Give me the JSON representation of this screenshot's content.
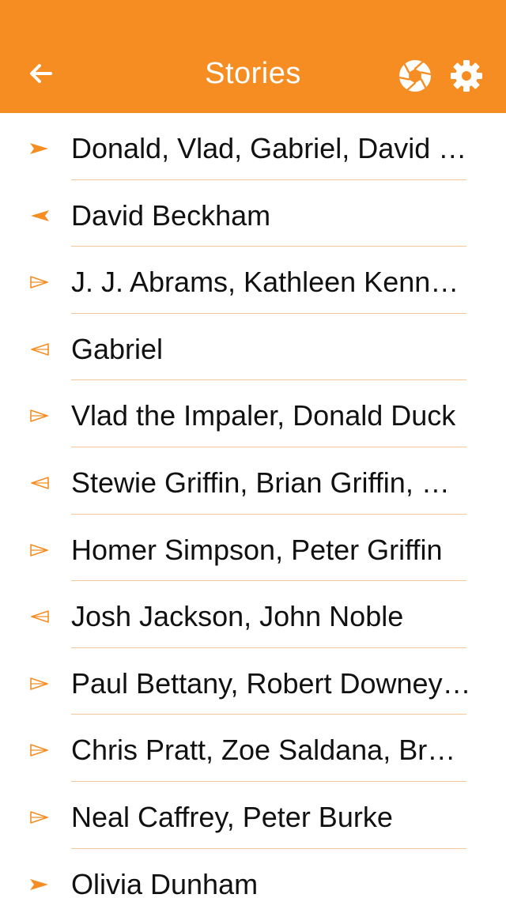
{
  "colors": {
    "accent": "#f68d23",
    "text": "#111111",
    "divider": "#f3c89a",
    "on_accent": "#ffffff"
  },
  "header": {
    "title": "Stories",
    "back_icon": "arrow-left-icon",
    "camera_icon": "camera-aperture-icon",
    "settings_icon": "gear-icon"
  },
  "stories": [
    {
      "label": "Donald, Vlad, Gabriel, David B…",
      "direction": "sent",
      "style": "filled"
    },
    {
      "label": "David Beckham",
      "direction": "received",
      "style": "filled"
    },
    {
      "label": "J. J. Abrams, Kathleen Kennedy",
      "direction": "sent",
      "style": "outline"
    },
    {
      "label": "Gabriel",
      "direction": "received",
      "style": "outline"
    },
    {
      "label": "Vlad the Impaler, Donald Duck",
      "direction": "sent",
      "style": "outline"
    },
    {
      "label": "Stewie Griffin, Brian Griffin, M…",
      "direction": "received",
      "style": "outline"
    },
    {
      "label": "Homer Simpson, Peter Griffin",
      "direction": "sent",
      "style": "outline"
    },
    {
      "label": "Josh Jackson, John Noble",
      "direction": "received",
      "style": "outline"
    },
    {
      "label": "Paul Bettany, Robert Downey Jr",
      "direction": "sent",
      "style": "outline"
    },
    {
      "label": "Chris Pratt, Zoe Saldana, Brad…",
      "direction": "sent",
      "style": "outline"
    },
    {
      "label": "Neal Caffrey, Peter Burke",
      "direction": "sent",
      "style": "outline"
    },
    {
      "label": "Olivia Dunham",
      "direction": "sent",
      "style": "filled"
    }
  ]
}
